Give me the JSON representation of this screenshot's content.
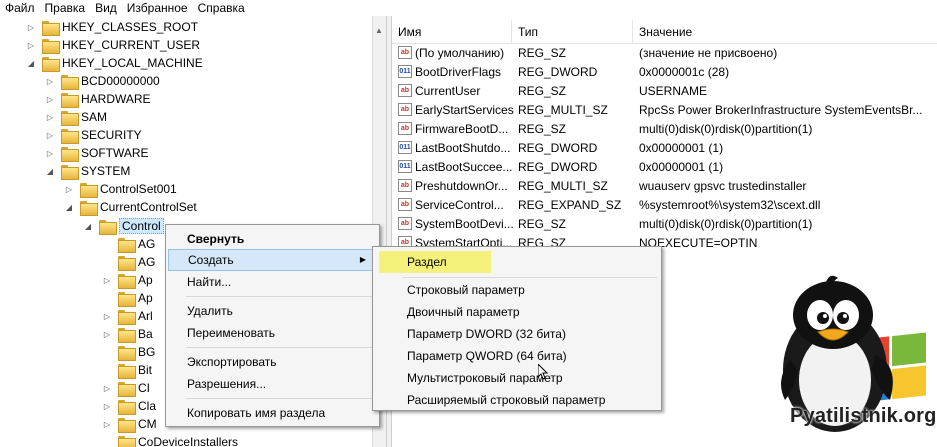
{
  "menu": [
    "Файл",
    "Правка",
    "Вид",
    "Избранное",
    "Справка"
  ],
  "tree": {
    "hkcr": "HKEY_CLASSES_ROOT",
    "hkcu": "HKEY_CURRENT_USER",
    "hklm": "HKEY_LOCAL_MACHINE",
    "bcd": "BCD00000000",
    "hardware": "HARDWARE",
    "sam": "SAM",
    "security": "SECURITY",
    "software": "SOFTWARE",
    "system": "SYSTEM",
    "controlset001": "ControlSet001",
    "currentcontrolset": "CurrentControlSet",
    "control": "Control",
    "children": [
      "AG",
      "AG",
      "Ap",
      "Ap",
      "Arl",
      "Ba",
      "BG",
      "Bit",
      "CI",
      "Cla",
      "CM"
    ],
    "codevice": "CoDeviceInstallers"
  },
  "list": {
    "headers": {
      "name": "Имя",
      "type": "Тип",
      "value": "Значение"
    },
    "rows": [
      {
        "icon": "ab",
        "name": "(По умолчанию)",
        "type": "REG_SZ",
        "value": "(значение не присвоено)"
      },
      {
        "icon": "dw",
        "name": "BootDriverFlags",
        "type": "REG_DWORD",
        "value": "0x0000001c (28)"
      },
      {
        "icon": "ab",
        "name": "CurrentUser",
        "type": "REG_SZ",
        "value": "USERNAME"
      },
      {
        "icon": "ab",
        "name": "EarlyStartServices",
        "type": "REG_MULTI_SZ",
        "value": "RpcSs Power BrokerInfrastructure SystemEventsBr..."
      },
      {
        "icon": "ab",
        "name": "FirmwareBootD...",
        "type": "REG_SZ",
        "value": "multi(0)disk(0)rdisk(0)partition(1)"
      },
      {
        "icon": "dw",
        "name": "LastBootShutdo...",
        "type": "REG_DWORD",
        "value": "0x00000001 (1)"
      },
      {
        "icon": "dw",
        "name": "LastBootSuccee...",
        "type": "REG_DWORD",
        "value": "0x00000001 (1)"
      },
      {
        "icon": "ab",
        "name": "PreshutdownOr...",
        "type": "REG_MULTI_SZ",
        "value": "wuauserv gpsvc trustedinstaller"
      },
      {
        "icon": "ab",
        "name": "ServiceControl...",
        "type": "REG_EXPAND_SZ",
        "value": "%systemroot%\\system32\\scext.dll"
      },
      {
        "icon": "ab",
        "name": "SystemBootDevi...",
        "type": "REG_SZ",
        "value": "multi(0)disk(0)rdisk(0)partition(1)"
      },
      {
        "icon": "ab",
        "name": "SystemStartOpti...",
        "type": "REG_SZ",
        "value": "NOEXECUTE=OPTIN"
      }
    ]
  },
  "context_menu": {
    "collapse": "Свернуть",
    "create": "Создать",
    "find": "Найти...",
    "delete": "Удалить",
    "rename": "Переименовать",
    "export": "Экспортировать",
    "permissions": "Разрешения...",
    "copy_key_name": "Копировать имя раздела"
  },
  "submenu": {
    "key": "Раздел",
    "string": "Строковый параметр",
    "binary": "Двоичный параметр",
    "dword": "Параметр DWORD (32 бита)",
    "qword": "Параметр QWORD (64 бита)",
    "multistring": "Мультистроковый параметр",
    "expandable": "Расширяемый строковый параметр"
  },
  "watermark": {
    "text": "Pyatilistnik.org"
  },
  "colors": {
    "selection": "#cde8ff",
    "menu_highlight": "#d5e7f8",
    "marker": "#f4f27a"
  }
}
